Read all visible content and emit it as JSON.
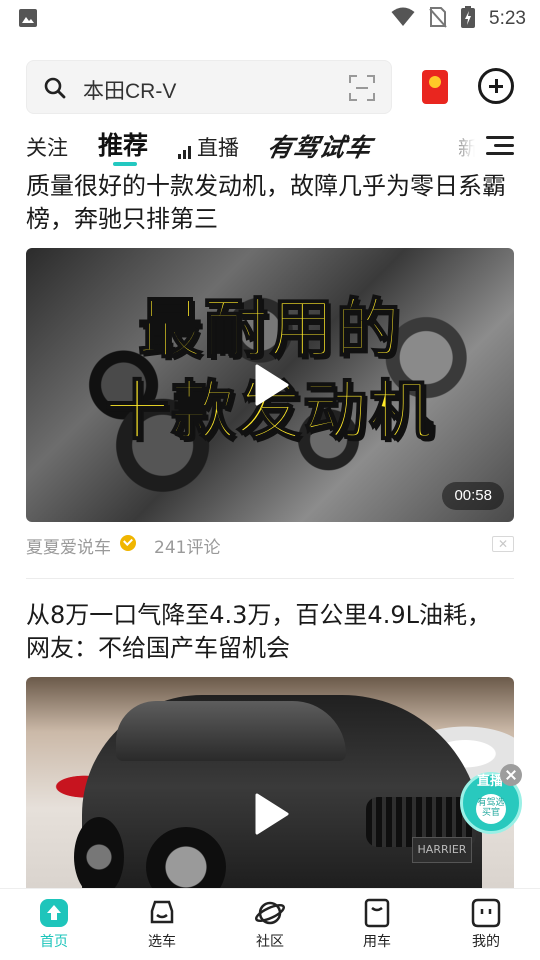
{
  "status_bar": {
    "time": "5:23",
    "icons": [
      "image-icon",
      "wifi-icon",
      "no-sim-icon",
      "battery-icon"
    ]
  },
  "search": {
    "value": "本田CR-V",
    "icons": [
      "search-icon",
      "scan-icon"
    ]
  },
  "header_actions": {
    "icons": [
      "red-packet-icon",
      "add-icon"
    ]
  },
  "tabs": {
    "items": [
      {
        "label": "关注",
        "active": false
      },
      {
        "label": "推荐",
        "active": true
      },
      {
        "label": "直播",
        "active": false
      },
      {
        "label": "有驾试车",
        "active": false
      },
      {
        "label": "新",
        "active": false
      }
    ],
    "menu_icon": "menu-icon",
    "accent_color": "#23c8c0"
  },
  "feed": {
    "articles": [
      {
        "title": "质量很好的十款发动机，故障几乎为零日系霸榜，奔驰只排第三",
        "thumbnail_text_line1": "最耐用的",
        "thumbnail_text_line2": "十款发动机",
        "duration": "00:58",
        "author": "夏夏爱说车",
        "comments": "241评论",
        "close_label": "✕"
      },
      {
        "title": "从8万一口气降至4.3万，百公里4.9L油耗，网友：不给国产车留机会",
        "plate_text": "HARRIER"
      }
    ]
  },
  "live_widget": {
    "label": "直播",
    "badge": "有驾选买官"
  },
  "bottom_nav": {
    "items": [
      {
        "label": "首页",
        "icon": "home-icon",
        "active": true
      },
      {
        "label": "选车",
        "icon": "car-select-icon",
        "active": false
      },
      {
        "label": "社区",
        "icon": "planet-icon",
        "active": false
      },
      {
        "label": "用车",
        "icon": "car-use-icon",
        "active": false
      },
      {
        "label": "我的",
        "icon": "profile-icon",
        "active": false
      }
    ],
    "active_color": "#1ec5bb"
  }
}
